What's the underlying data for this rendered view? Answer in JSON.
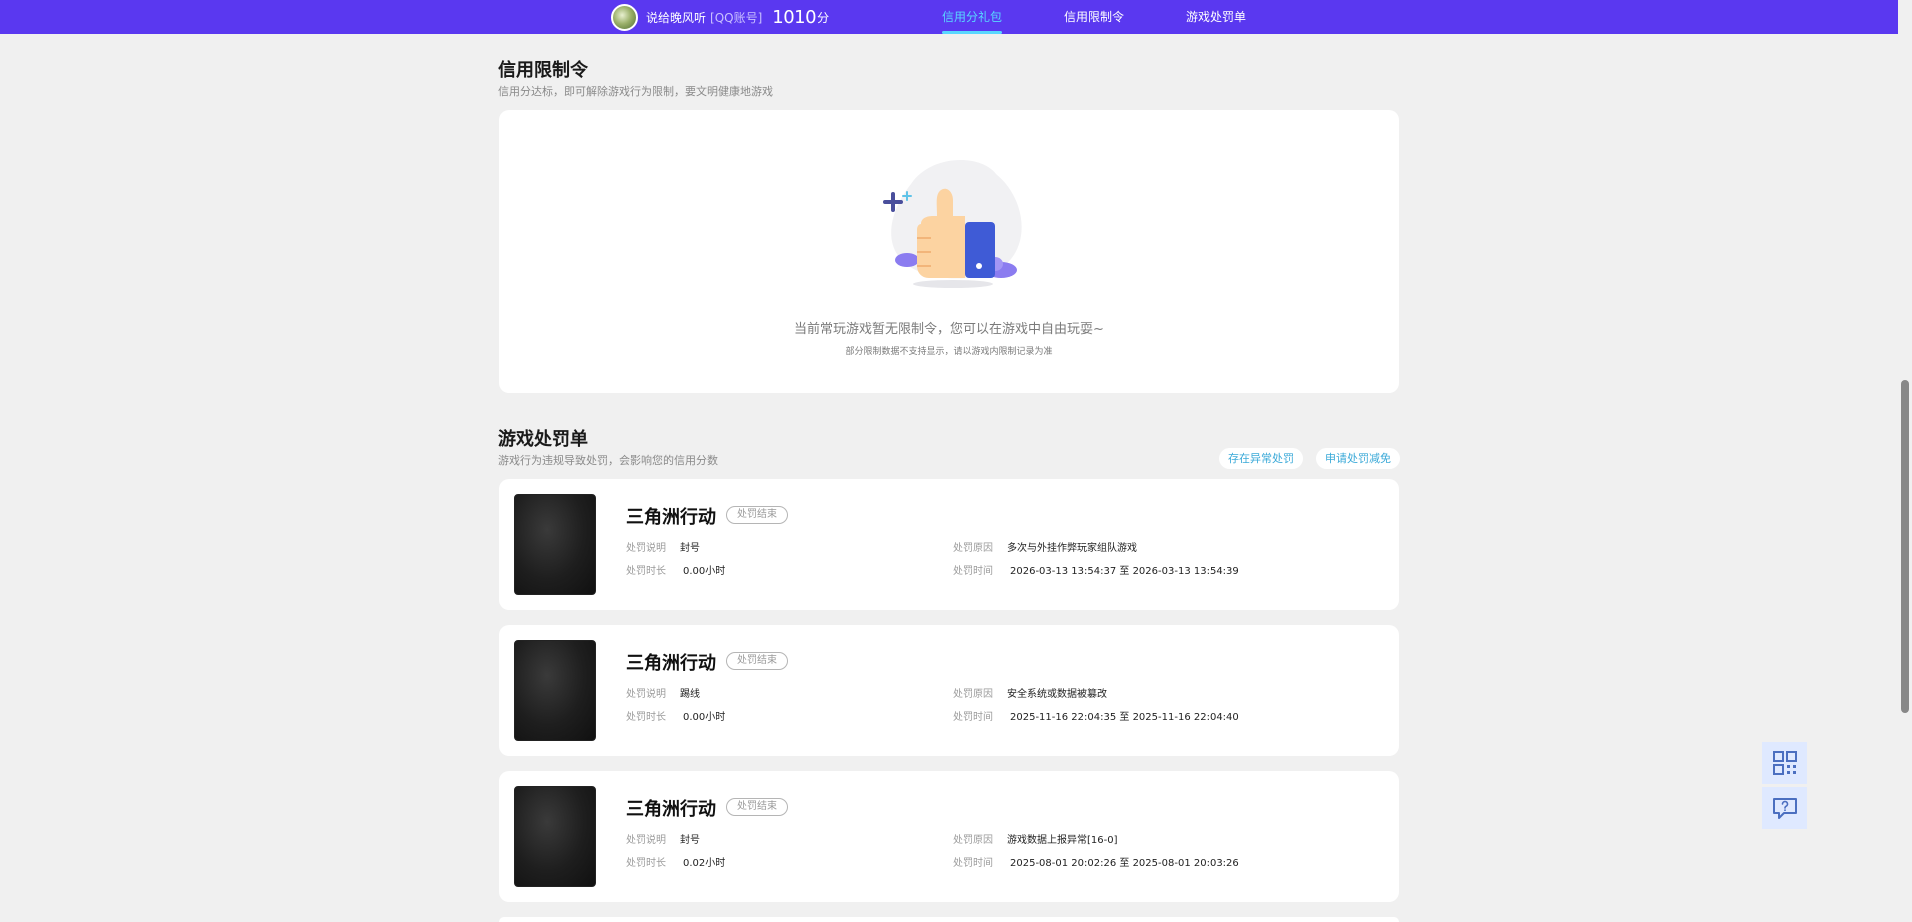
{
  "header": {
    "username": "说给晚风听",
    "account_type": "[QQ账号]",
    "score": "1010",
    "score_unit": "分",
    "tabs": [
      {
        "label": "信用分礼包",
        "active": true
      },
      {
        "label": "信用限制令",
        "active": false
      },
      {
        "label": "游戏处罚单",
        "active": false
      }
    ]
  },
  "restriction": {
    "title": "信用限制令",
    "subtitle": "信用分达标，即可解除游戏行为限制，要文明健康地游戏",
    "empty_main": "当前常玩游戏暂无限制令，您可以在游戏中自由玩耍~",
    "empty_sub": "部分限制数据不支持显示，请以游戏内限制记录为准"
  },
  "penalty": {
    "title": "游戏处罚单",
    "subtitle": "游戏行为违规导致处罚，会影响您的信用分数",
    "btn_abnormal": "存在异常处罚",
    "btn_apply": "申请处罚减免",
    "labels": {
      "desc": "处罚说明",
      "duration": "处罚时长",
      "reason": "处罚原因",
      "time": "处罚时间"
    },
    "items": [
      {
        "game": "三角洲行动",
        "status": "处罚结束",
        "desc": "封号",
        "duration": "0.00小时",
        "reason": "多次与外挂作弊玩家组队游戏",
        "time": "2026-03-13 13:54:37 至 2026-03-13 13:54:39"
      },
      {
        "game": "三角洲行动",
        "status": "处罚结束",
        "desc": "踢线",
        "duration": "0.00小时",
        "reason": "安全系统或数据被篡改",
        "time": "2025-11-16 22:04:35 至 2025-11-16 22:04:40"
      },
      {
        "game": "三角洲行动",
        "status": "处罚结束",
        "desc": "封号",
        "duration": "0.02小时",
        "reason": "游戏数据上报异常[16-0]",
        "time": "2025-08-01 20:02:26 至 2025-08-01 20:03:26"
      }
    ]
  },
  "side": {
    "icons": [
      "qrcode-icon",
      "feedback-icon"
    ]
  }
}
